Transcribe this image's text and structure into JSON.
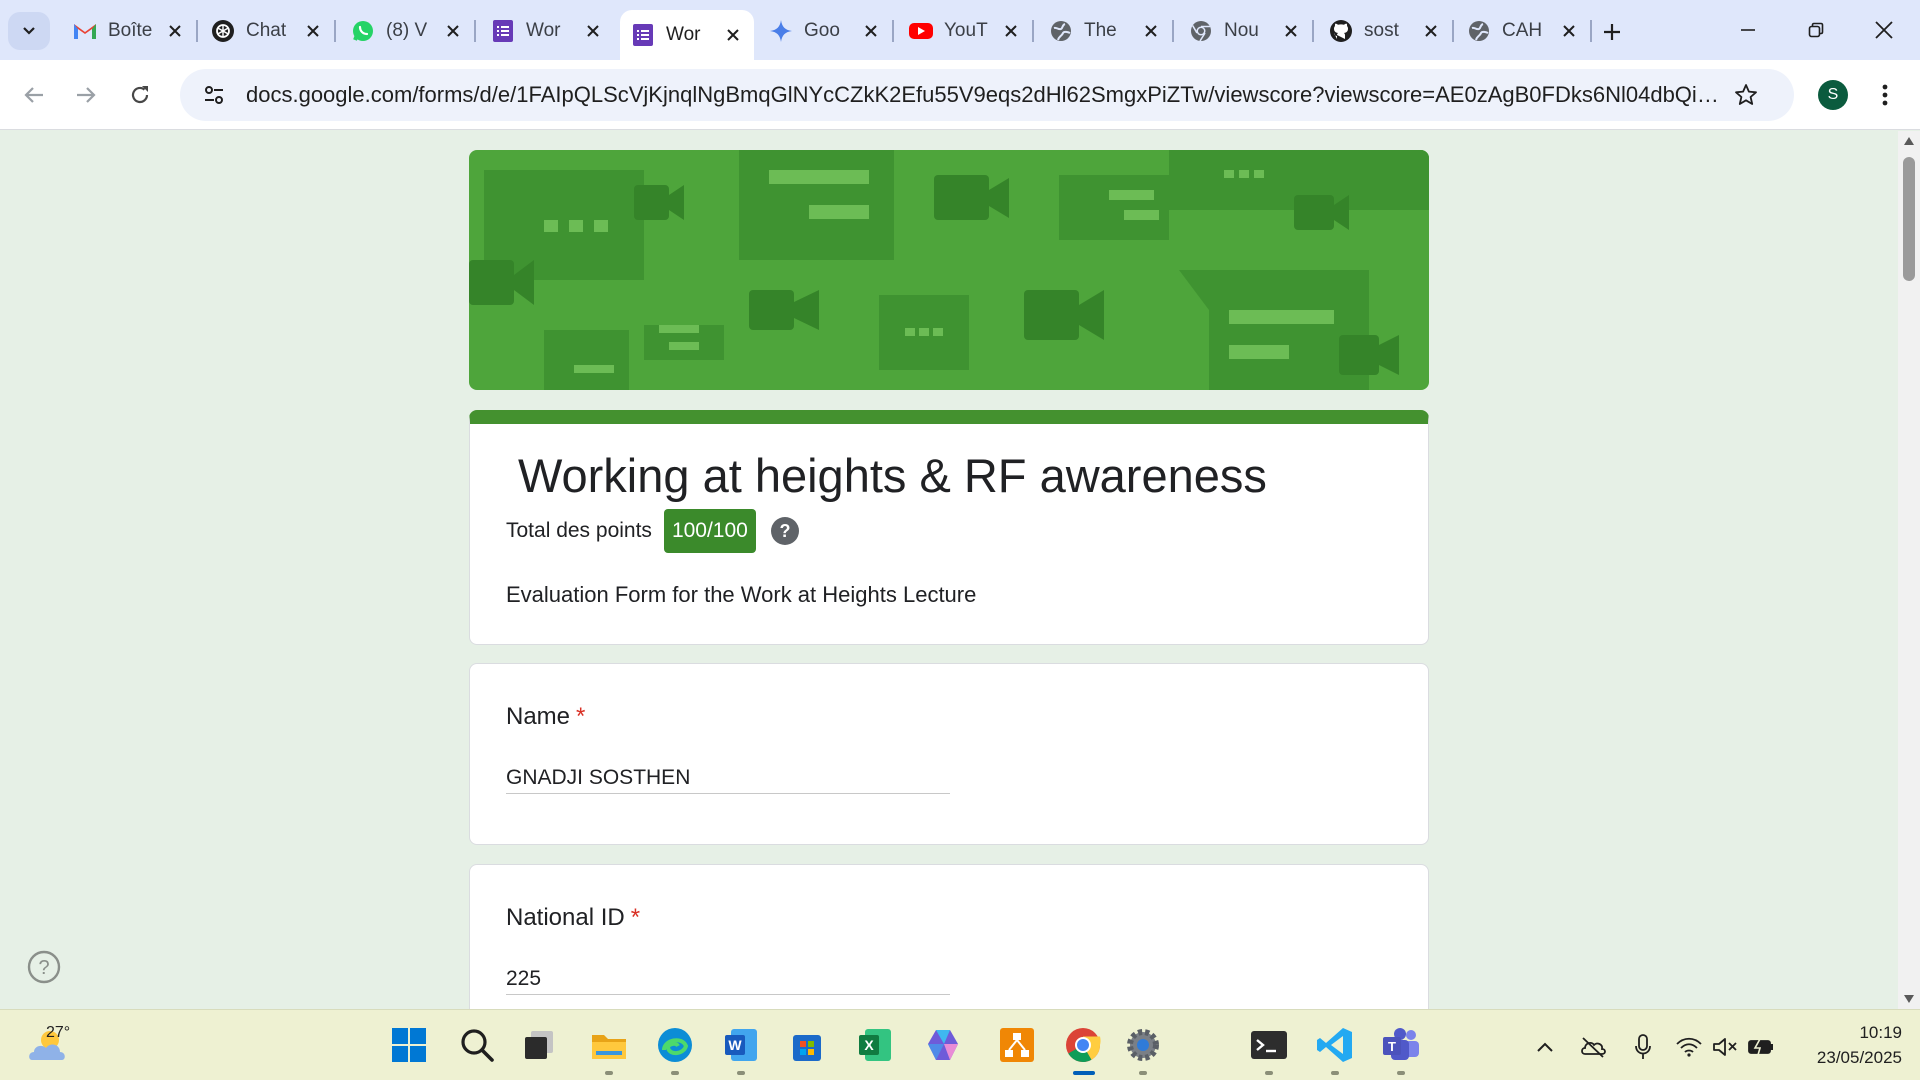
{
  "browser": {
    "tabs": [
      {
        "title": "Boîte",
        "icon": "gmail-icon",
        "active": false
      },
      {
        "title": "Chat",
        "icon": "chatgpt-icon",
        "active": false
      },
      {
        "title": "(8) V",
        "icon": "whatsapp-icon",
        "active": false
      },
      {
        "title": "Wor",
        "icon": "google-forms-icon",
        "active": false
      },
      {
        "title": "Wor",
        "icon": "google-forms-icon",
        "active": true
      },
      {
        "title": "Goo",
        "icon": "gemini-icon",
        "active": false
      },
      {
        "title": "YouT",
        "icon": "youtube-icon",
        "active": false
      },
      {
        "title": "The",
        "icon": "globe-icon",
        "active": false
      },
      {
        "title": "Nou",
        "icon": "chrome-icon",
        "active": false
      },
      {
        "title": "sost",
        "icon": "github-icon",
        "active": false
      },
      {
        "title": "CAH",
        "icon": "globe-icon",
        "active": false
      }
    ],
    "url": "docs.google.com/forms/d/e/1FAIpQLScVjKjnqlNgBmqGlNYcCZkK2Efu55V9eqs2dHl62SmgxPiZTw/viewscore?viewscore=AE0zAgB0FDks6Nl04dbQivoOrwHcAkX...",
    "profile_initial": "S"
  },
  "form": {
    "title": "Working at heights & RF awareness",
    "score_label": "Total des points",
    "score_value": "100/100",
    "description": "Evaluation Form for the Work at Heights Lecture",
    "questions": [
      {
        "label": "Name",
        "required_mark": "*",
        "answer": "GNADJI SOSTHEN"
      },
      {
        "label": "National ID",
        "required_mark": "*",
        "answer": "225"
      }
    ]
  },
  "taskbar": {
    "weather_temp": "27°",
    "apps": [
      "windows-start-icon",
      "search-icon",
      "task-view-icon",
      "file-explorer-icon",
      "edge-icon",
      "word-icon",
      "microsoft-store-icon",
      "excel-icon",
      "copilot-icon",
      "drawio-icon",
      "chrome-icon",
      "settings-icon",
      "terminal-icon",
      "vscode-icon",
      "teams-icon"
    ],
    "time": "10:19",
    "date": "23/05/2025"
  },
  "colors": {
    "accent_green": "#4ea53b",
    "score_badge": "#3b8a2b",
    "required_red": "#d93025",
    "page_background": "#e6f0e6"
  }
}
